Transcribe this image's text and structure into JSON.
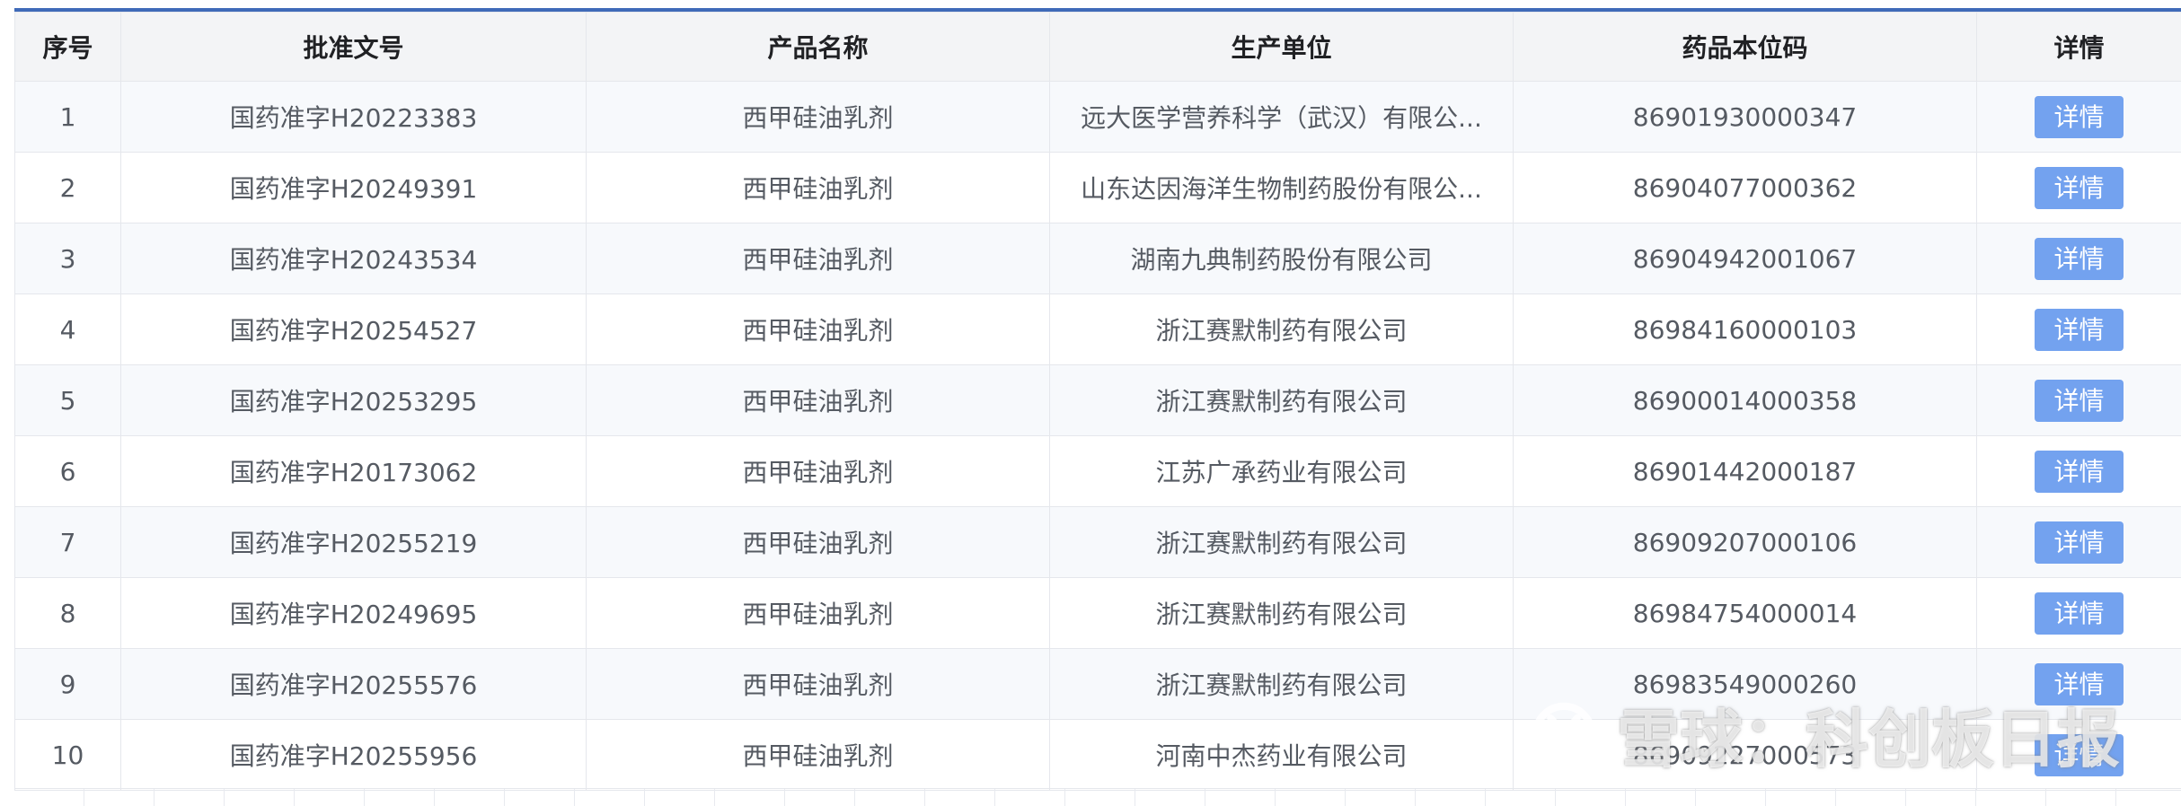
{
  "table": {
    "headers": [
      "序号",
      "批准文号",
      "产品名称",
      "生产单位",
      "药品本位码",
      "详情"
    ],
    "rows": [
      {
        "no": "1",
        "approval": "国药准字H20223383",
        "product": "西甲硅油乳剂",
        "manufacturer": "远大医学营养科学（武汉）有限公...",
        "code": "86901930000347",
        "detail_label": "详情"
      },
      {
        "no": "2",
        "approval": "国药准字H20249391",
        "product": "西甲硅油乳剂",
        "manufacturer": "山东达因海洋生物制药股份有限公...",
        "code": "86904077000362",
        "detail_label": "详情"
      },
      {
        "no": "3",
        "approval": "国药准字H20243534",
        "product": "西甲硅油乳剂",
        "manufacturer": "湖南九典制药股份有限公司",
        "code": "86904942001067",
        "detail_label": "详情"
      },
      {
        "no": "4",
        "approval": "国药准字H20254527",
        "product": "西甲硅油乳剂",
        "manufacturer": "浙江赛默制药有限公司",
        "code": "86984160000103",
        "detail_label": "详情"
      },
      {
        "no": "5",
        "approval": "国药准字H20253295",
        "product": "西甲硅油乳剂",
        "manufacturer": "浙江赛默制药有限公司",
        "code": "86900014000358",
        "detail_label": "详情"
      },
      {
        "no": "6",
        "approval": "国药准字H20173062",
        "product": "西甲硅油乳剂",
        "manufacturer": "江苏广承药业有限公司",
        "code": "86901442000187",
        "detail_label": "详情"
      },
      {
        "no": "7",
        "approval": "国药准字H20255219",
        "product": "西甲硅油乳剂",
        "manufacturer": "浙江赛默制药有限公司",
        "code": "86909207000106",
        "detail_label": "详情"
      },
      {
        "no": "8",
        "approval": "国药准字H20249695",
        "product": "西甲硅油乳剂",
        "manufacturer": "浙江赛默制药有限公司",
        "code": "86984754000014",
        "detail_label": "详情"
      },
      {
        "no": "9",
        "approval": "国药准字H20255576",
        "product": "西甲硅油乳剂",
        "manufacturer": "浙江赛默制药有限公司",
        "code": "86983549000260",
        "detail_label": "详情"
      },
      {
        "no": "10",
        "approval": "国药准字H20255956",
        "product": "西甲硅油乳剂",
        "manufacturer": "河南中杰药业有限公司",
        "code": "86909227000573",
        "detail_label": "详情"
      }
    ]
  },
  "watermark": {
    "text": "雪球：科创板日报",
    "icon": "snowball-logo-icon"
  },
  "colors": {
    "accent_line": "#3f6ab8",
    "button": "#73a2ef",
    "header_bg": "#f3f4f6"
  }
}
